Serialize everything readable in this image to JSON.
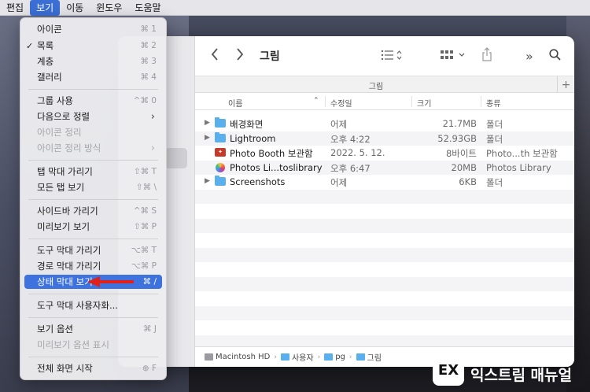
{
  "menubar": {
    "items": [
      "편집",
      "보기",
      "이동",
      "윈도우",
      "도움말"
    ],
    "active_index": 1
  },
  "view_menu": {
    "items": [
      {
        "label": "아이콘",
        "shortcut": "⌘ 1",
        "checked": false,
        "disabled": false
      },
      {
        "label": "목록",
        "shortcut": "⌘ 2",
        "checked": true,
        "disabled": false
      },
      {
        "label": "계층",
        "shortcut": "⌘ 3",
        "checked": false,
        "disabled": false
      },
      {
        "label": "갤러리",
        "shortcut": "⌘ 4",
        "checked": false,
        "disabled": false
      },
      {
        "label": "그룹 사용",
        "shortcut": "^⌘ 0",
        "disabled": false
      },
      {
        "label": "다음으로 정렬",
        "submenu": true,
        "disabled": false
      },
      {
        "label": "아이콘 정리",
        "disabled": true
      },
      {
        "label": "아이콘 정리 방식",
        "submenu": true,
        "disabled": true
      },
      {
        "label": "탭 막대 가리기",
        "shortcut": "⇧⌘ T",
        "disabled": false
      },
      {
        "label": "모든 탭 보기",
        "shortcut": "⇧⌘ \\",
        "disabled": false
      },
      {
        "label": "사이드바 가리기",
        "shortcut": "^⌘ S",
        "disabled": false
      },
      {
        "label": "미리보기 보기",
        "shortcut": "⇧⌘ P",
        "disabled": false
      },
      {
        "label": "도구 막대 가리기",
        "shortcut": "⌥⌘ T",
        "disabled": false
      },
      {
        "label": "경로 막대 가리기",
        "shortcut": "⌥⌘ P",
        "disabled": false
      },
      {
        "label": "상태 막대 보기",
        "shortcut": "⌘ /",
        "disabled": false,
        "highlighted": true
      },
      {
        "label": "도구 막대 사용자화...",
        "disabled": false
      },
      {
        "label": "보기 옵션",
        "shortcut": "⌘ J",
        "disabled": false
      },
      {
        "label": "미리보기 옵션 표시",
        "disabled": true
      },
      {
        "label": "전체 화면 시작",
        "shortcut": "⊕ F",
        "disabled": false
      }
    ]
  },
  "finder": {
    "title": "그림",
    "tab_label": "그림",
    "columns": {
      "name": "이름",
      "date": "수정일",
      "size": "크기",
      "kind": "종류"
    },
    "files": [
      {
        "name": "배경화면",
        "date": "어제",
        "size": "21.7MB",
        "kind": "폴더",
        "icon": "folder-icon",
        "expandable": true
      },
      {
        "name": "Lightroom",
        "date": "오후 4:22",
        "size": "52.93GB",
        "kind": "폴더",
        "icon": "folder-icon",
        "expandable": true
      },
      {
        "name": "Photo Booth 보관함",
        "date": "2022. 5. 12.",
        "size": "8바이트",
        "kind": "Photo...th 보관함",
        "icon": "photo-booth-icon",
        "expandable": false
      },
      {
        "name": "Photos Li...toslibrary",
        "date": "오후 6:47",
        "size": "20MB",
        "kind": "Photos Library",
        "icon": "photos-library-icon",
        "expandable": false
      },
      {
        "name": "Screenshots",
        "date": "어제",
        "size": "6KB",
        "kind": "폴더",
        "icon": "folder-icon",
        "expandable": true
      }
    ],
    "path": [
      "Macintosh HD",
      "사용자",
      "pg",
      "그림"
    ]
  },
  "watermark": {
    "tagline": "More Better IT Life",
    "name": "익스트림 매뉴얼",
    "logo": "EX"
  }
}
